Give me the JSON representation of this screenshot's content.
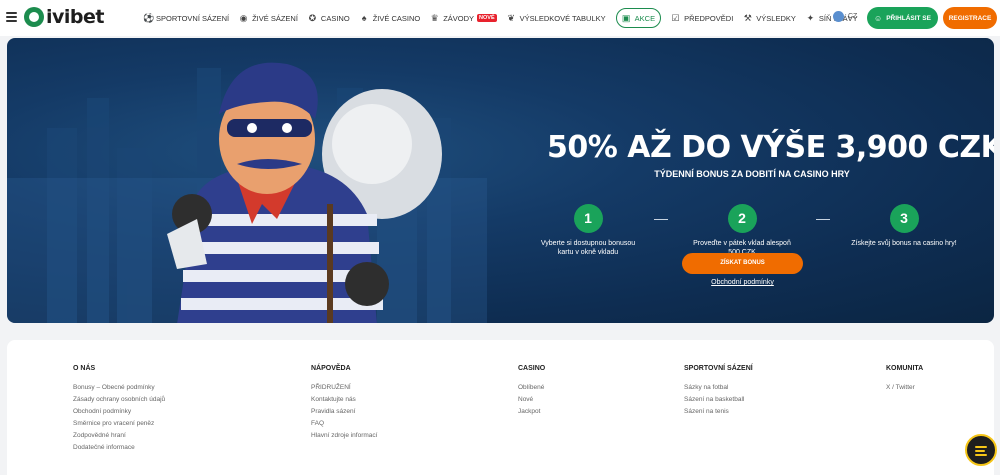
{
  "header": {
    "logo_text": "ivibet",
    "nav": [
      {
        "label": "SPORTOVNÍ SÁZENÍ",
        "icon": "soccer-ball-icon"
      },
      {
        "label": "ŽIVÉ SÁZENÍ",
        "icon": "live-icon"
      },
      {
        "label": "CASINO",
        "icon": "casino-chip-icon"
      },
      {
        "label": "ŽIVÉ CASINO",
        "icon": "live-casino-icon"
      },
      {
        "label": "ZÁVODY",
        "icon": "trophy-icon",
        "badge": "NOVÉ"
      },
      {
        "label": "VÝSLEDKOVÉ TABULKY",
        "icon": "laurel-icon"
      },
      {
        "label": "AKCE",
        "icon": "gift-icon"
      },
      {
        "label": "PŘEDPOVĚDI",
        "icon": "predictions-icon"
      },
      {
        "label": "VÝSLEDKY",
        "icon": "results-icon"
      },
      {
        "label": "SÍŇ SLÁVY",
        "icon": "hall-of-fame-icon"
      }
    ],
    "lang": "CZ",
    "login_label": "PŘIHLÁSIT SE",
    "register_label": "REGISTRACE"
  },
  "promo": {
    "title": "50% AŽ DO VÝŠE 3,900 CZK",
    "subtitle": "TÝDENNÍ BONUS ZA DOBITÍ NA CASINO HRY",
    "steps": [
      {
        "num": "1",
        "text": "Vyberte si dostupnou bonusou kartu v okně vkladu"
      },
      {
        "num": "2",
        "text": "Proveďte v pátek vklad alespoň 500 CZK"
      },
      {
        "num": "3",
        "text": "Získejte svůj bonus na casino hry!"
      }
    ],
    "cta_label": "ZÍSKAT BONUS",
    "terms_label": "Obchodní podmínky"
  },
  "footer": {
    "columns": [
      {
        "title": "O NÁS",
        "links": [
          "Bonusy – Obecné podmínky",
          "Zásady ochrany osobních údajů",
          "Obchodní podmínky",
          "Směrnice pro vracení peněz",
          "Zodpovědné hraní",
          "Dodatečné informace"
        ]
      },
      {
        "title": "NÁPOVĚDA",
        "links": [
          "PŘIDRUŽENÍ",
          "Kontaktujte nás",
          "Pravidla sázení",
          "FAQ",
          "Hlavní zdroje informací"
        ]
      },
      {
        "title": "CASINO",
        "links": [
          "Oblíbené",
          "Nové",
          "Jackpot"
        ]
      },
      {
        "title": "SPORTOVNÍ SÁZENÍ",
        "links": [
          "Sázky na fotbal",
          "Sázení na basketball",
          "Sázení na tenis"
        ]
      },
      {
        "title": "KOMUNITA",
        "links": [
          "X / Twitter"
        ]
      }
    ]
  },
  "colors": {
    "brand_green": "#1aa35a",
    "brand_orange": "#f06c00",
    "banner_blue": "#143a66"
  }
}
